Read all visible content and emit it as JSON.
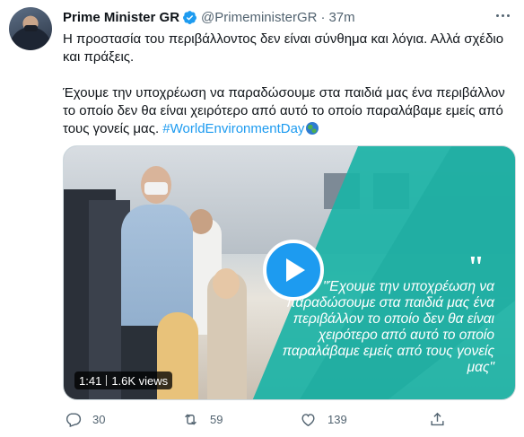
{
  "tweet": {
    "author_name": "Prime Minister GR",
    "handle": "@PrimeministerGR",
    "separator": "·",
    "time": "37m",
    "text_line1": "Η προστασία του περιβάλλοντος δεν είναι σύνθημα και λόγια. Αλλά σχέδιο και πράξεις.",
    "text_line2": "Έχουμε την υποχρέωση να παραδώσουμε στα παιδιά μας ένα περιβάλλον το οποίο δεν θα είναι χειρότερο από αυτό το οποίο παραλάβαμε εμείς από τους γονείς μας.",
    "hashtag": "#WorldEnvironmentDay"
  },
  "media": {
    "quote_mark": "\"",
    "quote_text": "\"Έχουμε την υποχρέωση να παραδώσουμε στα παιδιά μας ένα περιβάλλον το οποίο δεν θα είναι χειρότερο από αυτό το οποίο παραλάβαμε εμείς από τους γονείς μας\"",
    "duration": "1:41",
    "views": "1.6K views"
  },
  "actions": {
    "replies": "30",
    "retweets": "59",
    "likes": "139"
  },
  "colors": {
    "accent": "#1d9bf0",
    "overlay_teal": "#1bb3a6",
    "secondary_text": "#536471"
  },
  "icons": [
    "verified-badge-icon",
    "more-icon",
    "play-icon",
    "globe-emoji-icon",
    "reply-icon",
    "retweet-icon",
    "like-icon",
    "share-icon"
  ]
}
